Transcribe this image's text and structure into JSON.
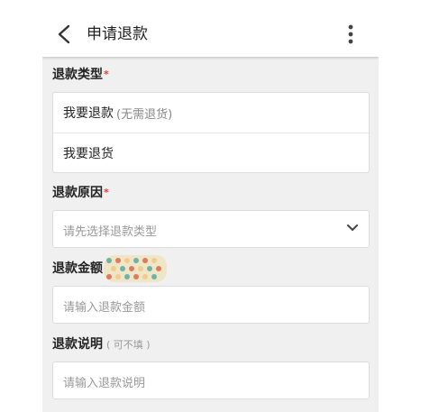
{
  "header": {
    "title": "申请退款"
  },
  "refund_type": {
    "label": "退款类型",
    "required_mark": "*",
    "options": [
      {
        "label": "我要退款",
        "hint": "(无需退货)"
      },
      {
        "label": "我要退货",
        "hint": ""
      }
    ]
  },
  "refund_reason": {
    "label": "退款原因",
    "required_mark": "*",
    "placeholder": "请先选择退款类型"
  },
  "refund_amount": {
    "label": "退款金额",
    "placeholder": "请输入退款金额"
  },
  "refund_note": {
    "label": "退款说明",
    "optional_note": "( 可不填 )",
    "placeholder": "请输入退款说明"
  },
  "colors": {
    "page_background": "#f0f0f0",
    "card_background": "#ffffff",
    "required_star": "#e53935",
    "placeholder_text": "#999999"
  },
  "icons": [
    "back-arrow-icon",
    "more-vertical-icon",
    "chevron-down-icon"
  ]
}
